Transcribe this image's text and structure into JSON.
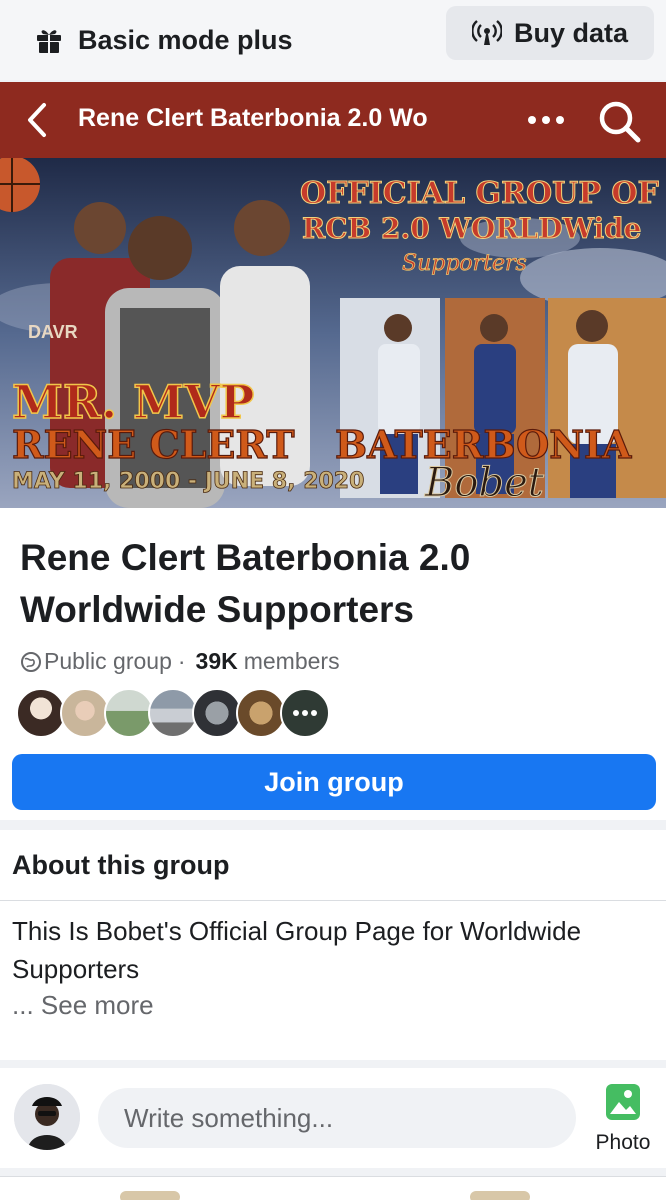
{
  "topbar": {
    "basic_mode_label": "Basic mode plus",
    "basic_mode_icon": "gift-icon",
    "buy_data_label": "Buy data",
    "buy_data_icon": "signal-icon"
  },
  "header": {
    "title": "Rene Clert Baterbonia 2.0 Wo",
    "back_icon": "chevron-left-icon",
    "more_icon": "more-icon",
    "search_icon": "search-icon",
    "color": "#8e2a1f"
  },
  "cover": {
    "headline_line1": "OFFICIAL GROUP OF",
    "headline_line2": "RCB 2.0 WORLDWide",
    "headline_line3": "Supporters",
    "mr_mvp": "MR. MVP",
    "name": "RENE CLERT",
    "surname": "BATERBONIA",
    "dates": "MAY 11, 2000 - JUNE 8, 2020",
    "nickname": "Bobet",
    "jersey_text": "DAVR"
  },
  "group": {
    "title": "Rene Clert Baterbonia 2.0 Worldwide Supporters",
    "privacy": "Public group",
    "separator": "·",
    "member_count": "39K",
    "members_label": "members",
    "join_label": "Join group",
    "join_color": "#1877f2"
  },
  "about": {
    "heading": "About this group",
    "description": "This Is Bobet's Official Group Page for Worldwide Supporters",
    "see_more": "... See more"
  },
  "composer": {
    "placeholder": "Write something...",
    "photo_label": "Photo",
    "photo_icon": "photo-icon"
  }
}
